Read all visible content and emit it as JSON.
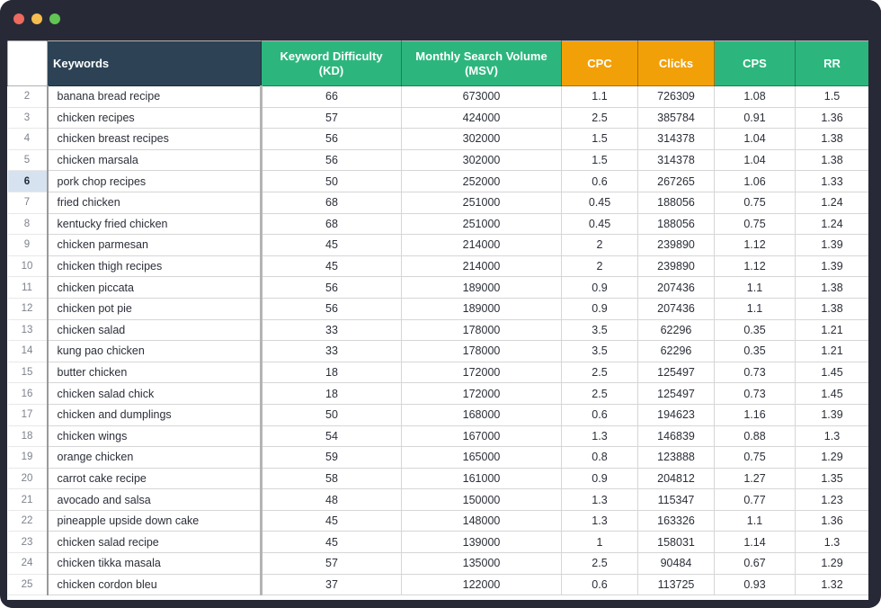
{
  "window": {
    "traffic_lights": [
      {
        "name": "close-button",
        "color": "#ec6a5e"
      },
      {
        "name": "minimize-button",
        "color": "#f4bd4f"
      },
      {
        "name": "maximize-button",
        "color": "#61c554"
      }
    ],
    "chrome_color": "#272a36"
  },
  "spreadsheet": {
    "header_row_number": "1",
    "selected_row_number": "6",
    "columns": [
      {
        "key": "num",
        "label": "",
        "style": "row-number",
        "bg": "#ffffff"
      },
      {
        "key": "kw",
        "label": "Keywords",
        "style": "dark",
        "bg": "#2d4355"
      },
      {
        "key": "kd",
        "label": "Keyword Difficulty (KD)",
        "style": "green",
        "bg": "#2cb67d"
      },
      {
        "key": "msv",
        "label": "Monthly Search Volume (MSV)",
        "style": "green",
        "bg": "#2cb67d"
      },
      {
        "key": "cpc",
        "label": "CPC",
        "style": "orange",
        "bg": "#f2a007"
      },
      {
        "key": "clicks",
        "label": "Clicks",
        "style": "orange",
        "bg": "#f2a007"
      },
      {
        "key": "cps",
        "label": "CPS",
        "style": "green",
        "bg": "#2cb67d"
      },
      {
        "key": "rr",
        "label": "RR",
        "style": "green",
        "bg": "#2cb67d"
      }
    ],
    "header_labels": {
      "keywords": "Keywords",
      "kd_line1": "Keyword Difficulty",
      "kd_line2": "(KD)",
      "msv_line1": "Monthly Search Volume",
      "msv_line2": "(MSV)",
      "cpc": "CPC",
      "clicks": "Clicks",
      "cps": "CPS",
      "rr": "RR"
    },
    "rows": [
      {
        "num": "2",
        "keyword": "banana bread recipe",
        "kd": "66",
        "msv": "673000",
        "cpc": "1.1",
        "clicks": "726309",
        "cps": "1.08",
        "rr": "1.5"
      },
      {
        "num": "3",
        "keyword": "chicken recipes",
        "kd": "57",
        "msv": "424000",
        "cpc": "2.5",
        "clicks": "385784",
        "cps": "0.91",
        "rr": "1.36"
      },
      {
        "num": "4",
        "keyword": "chicken breast recipes",
        "kd": "56",
        "msv": "302000",
        "cpc": "1.5",
        "clicks": "314378",
        "cps": "1.04",
        "rr": "1.38"
      },
      {
        "num": "5",
        "keyword": "chicken marsala",
        "kd": "56",
        "msv": "302000",
        "cpc": "1.5",
        "clicks": "314378",
        "cps": "1.04",
        "rr": "1.38"
      },
      {
        "num": "6",
        "keyword": "pork chop recipes",
        "kd": "50",
        "msv": "252000",
        "cpc": "0.6",
        "clicks": "267265",
        "cps": "1.06",
        "rr": "1.33"
      },
      {
        "num": "7",
        "keyword": "fried chicken",
        "kd": "68",
        "msv": "251000",
        "cpc": "0.45",
        "clicks": "188056",
        "cps": "0.75",
        "rr": "1.24"
      },
      {
        "num": "8",
        "keyword": "kentucky fried chicken",
        "kd": "68",
        "msv": "251000",
        "cpc": "0.45",
        "clicks": "188056",
        "cps": "0.75",
        "rr": "1.24"
      },
      {
        "num": "9",
        "keyword": "chicken parmesan",
        "kd": "45",
        "msv": "214000",
        "cpc": "2",
        "clicks": "239890",
        "cps": "1.12",
        "rr": "1.39"
      },
      {
        "num": "10",
        "keyword": "chicken thigh recipes",
        "kd": "45",
        "msv": "214000",
        "cpc": "2",
        "clicks": "239890",
        "cps": "1.12",
        "rr": "1.39"
      },
      {
        "num": "11",
        "keyword": "chicken piccata",
        "kd": "56",
        "msv": "189000",
        "cpc": "0.9",
        "clicks": "207436",
        "cps": "1.1",
        "rr": "1.38"
      },
      {
        "num": "12",
        "keyword": "chicken pot pie",
        "kd": "56",
        "msv": "189000",
        "cpc": "0.9",
        "clicks": "207436",
        "cps": "1.1",
        "rr": "1.38"
      },
      {
        "num": "13",
        "keyword": "chicken salad",
        "kd": "33",
        "msv": "178000",
        "cpc": "3.5",
        "clicks": "62296",
        "cps": "0.35",
        "rr": "1.21"
      },
      {
        "num": "14",
        "keyword": "kung pao chicken",
        "kd": "33",
        "msv": "178000",
        "cpc": "3.5",
        "clicks": "62296",
        "cps": "0.35",
        "rr": "1.21"
      },
      {
        "num": "15",
        "keyword": "butter chicken",
        "kd": "18",
        "msv": "172000",
        "cpc": "2.5",
        "clicks": "125497",
        "cps": "0.73",
        "rr": "1.45"
      },
      {
        "num": "16",
        "keyword": "chicken salad chick",
        "kd": "18",
        "msv": "172000",
        "cpc": "2.5",
        "clicks": "125497",
        "cps": "0.73",
        "rr": "1.45"
      },
      {
        "num": "17",
        "keyword": "chicken and dumplings",
        "kd": "50",
        "msv": "168000",
        "cpc": "0.6",
        "clicks": "194623",
        "cps": "1.16",
        "rr": "1.39"
      },
      {
        "num": "18",
        "keyword": "chicken wings",
        "kd": "54",
        "msv": "167000",
        "cpc": "1.3",
        "clicks": "146839",
        "cps": "0.88",
        "rr": "1.3"
      },
      {
        "num": "19",
        "keyword": "orange chicken",
        "kd": "59",
        "msv": "165000",
        "cpc": "0.8",
        "clicks": "123888",
        "cps": "0.75",
        "rr": "1.29"
      },
      {
        "num": "20",
        "keyword": "carrot cake recipe",
        "kd": "58",
        "msv": "161000",
        "cpc": "0.9",
        "clicks": "204812",
        "cps": "1.27",
        "rr": "1.35"
      },
      {
        "num": "21",
        "keyword": "avocado and salsa",
        "kd": "48",
        "msv": "150000",
        "cpc": "1.3",
        "clicks": "115347",
        "cps": "0.77",
        "rr": "1.23"
      },
      {
        "num": "22",
        "keyword": "pineapple upside down cake",
        "kd": "45",
        "msv": "148000",
        "cpc": "1.3",
        "clicks": "163326",
        "cps": "1.1",
        "rr": "1.36"
      },
      {
        "num": "23",
        "keyword": "chicken salad recipe",
        "kd": "45",
        "msv": "139000",
        "cpc": "1",
        "clicks": "158031",
        "cps": "1.14",
        "rr": "1.3"
      },
      {
        "num": "24",
        "keyword": "chicken tikka masala",
        "kd": "57",
        "msv": "135000",
        "cpc": "2.5",
        "clicks": "90484",
        "cps": "0.67",
        "rr": "1.29"
      },
      {
        "num": "25",
        "keyword": "chicken cordon bleu",
        "kd": "37",
        "msv": "122000",
        "cpc": "0.6",
        "clicks": "113725",
        "cps": "0.93",
        "rr": "1.32"
      }
    ]
  }
}
